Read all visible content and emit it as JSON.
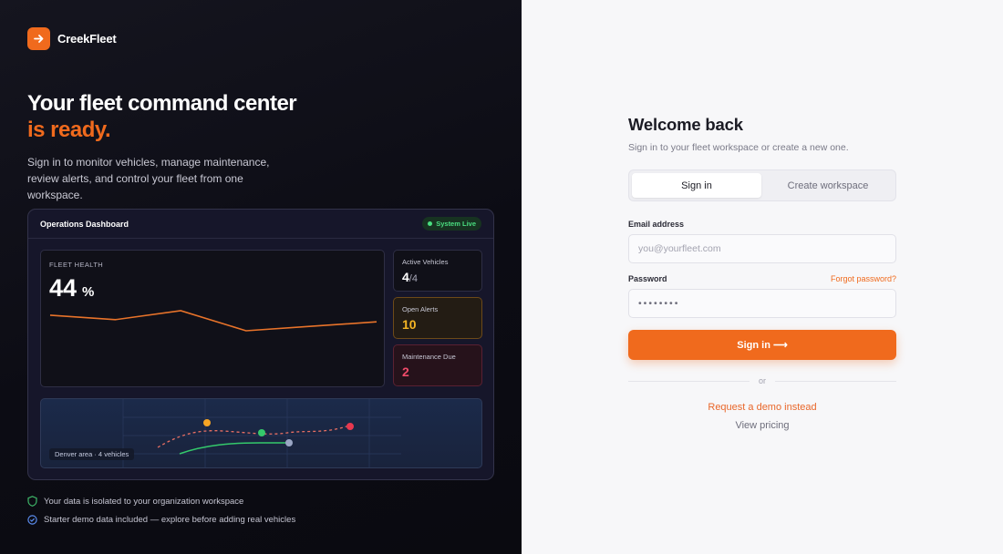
{
  "brand": {
    "name": "CreekFleet",
    "logo_icon": "arrow-right-icon",
    "accent": "#f06a1d"
  },
  "hero": {
    "line1": "Your fleet command center",
    "line2": "is ready.",
    "subtitle": "Sign in to monitor vehicles, manage maintenance, review alerts, and control your fleet from one workspace."
  },
  "dashboard": {
    "title": "Operations Dashboard",
    "status": "System Live",
    "health": {
      "label": "FLEET HEALTH",
      "value": "44",
      "unit": "%",
      "trend": [
        20,
        18,
        22,
        13,
        15,
        17
      ]
    },
    "stats": [
      {
        "label": "Active Vehicles",
        "value": "4",
        "denominator": "/4",
        "color": "#ffffff"
      },
      {
        "label": "Open Alerts",
        "value": "10",
        "color": "#f5b524"
      },
      {
        "label": "Maintenance Due",
        "value": "2",
        "color": "#f04b6a"
      }
    ],
    "map": {
      "label": "Denver area · 4 vehicles"
    }
  },
  "notes": [
    {
      "icon": "shield-check-icon",
      "text": "Your data is isolated to your organization workspace"
    },
    {
      "icon": "check-circle-icon",
      "text": "Starter demo data included — explore before adding real vehicles"
    }
  ],
  "auth": {
    "title": "Welcome back",
    "subtitle": "Sign in to your fleet workspace or create a new one.",
    "tabs": [
      {
        "label": "Sign in",
        "active": true
      },
      {
        "label": "Create workspace",
        "active": false
      }
    ],
    "email": {
      "label": "Email address",
      "placeholder": "you@yourfleet.com",
      "value": ""
    },
    "password": {
      "label": "Password",
      "value": "••••••••",
      "forgot": "Forgot password?"
    },
    "submit": "Sign in ⟶",
    "divider": "or",
    "demo_link": "Request a demo instead",
    "pricing_link": "View pricing"
  }
}
